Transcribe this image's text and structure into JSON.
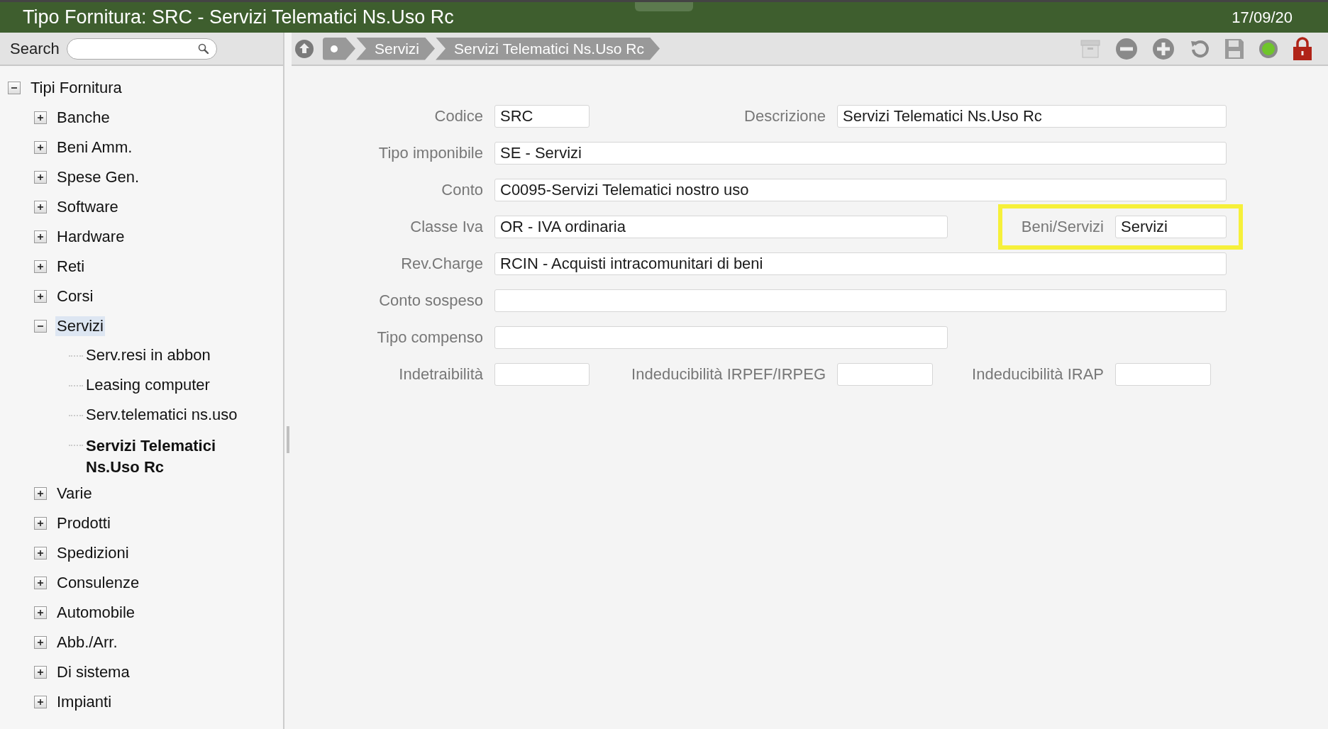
{
  "window": {
    "title": "Tipo Fornitura: SRC - Servizi Telematici Ns.Uso Rc",
    "date": "17/09/20"
  },
  "search": {
    "label": "Search"
  },
  "tree": {
    "label": "Tipi Fornitura",
    "expanded": true,
    "children": [
      {
        "label": "Banche",
        "expanded": false,
        "selected": false,
        "active": false
      },
      {
        "label": "Beni Amm.",
        "expanded": false,
        "selected": false,
        "active": false
      },
      {
        "label": "Spese Gen.",
        "expanded": false,
        "selected": false,
        "active": false
      },
      {
        "label": "Software",
        "expanded": false,
        "selected": false,
        "active": false
      },
      {
        "label": "Hardware",
        "expanded": false,
        "selected": false,
        "active": false
      },
      {
        "label": "Reti",
        "expanded": false,
        "selected": false,
        "active": false
      },
      {
        "label": "Corsi",
        "expanded": false,
        "selected": false,
        "active": false
      },
      {
        "label": "Servizi",
        "expanded": true,
        "selected": true,
        "active": false,
        "children": [
          {
            "label": "Serv.resi in abbon",
            "selected": false,
            "active": false
          },
          {
            "label": "Leasing computer",
            "selected": false,
            "active": false
          },
          {
            "label": "Serv.telematici ns.uso",
            "selected": false,
            "active": false
          },
          {
            "label": "Servizi Telematici Ns.Uso Rc",
            "selected": false,
            "active": true
          }
        ]
      },
      {
        "label": "Varie",
        "expanded": false,
        "selected": false,
        "active": false
      },
      {
        "label": "Prodotti",
        "expanded": false,
        "selected": false,
        "active": false
      },
      {
        "label": "Spedizioni",
        "expanded": false,
        "selected": false,
        "active": false
      },
      {
        "label": "Consulenze",
        "expanded": false,
        "selected": false,
        "active": false
      },
      {
        "label": "Automobile",
        "expanded": false,
        "selected": false,
        "active": false
      },
      {
        "label": "Abb./Arr.",
        "expanded": false,
        "selected": false,
        "active": false
      },
      {
        "label": "Di sistema",
        "expanded": false,
        "selected": false,
        "active": false
      },
      {
        "label": "Impianti",
        "expanded": false,
        "selected": false,
        "active": false
      }
    ]
  },
  "breadcrumb": [
    "Servizi",
    "Servizi Telematici Ns.Uso Rc"
  ],
  "form": [
    [
      {
        "label": "Codice",
        "value": "SRC",
        "highlighted": false
      },
      {
        "label": "Descrizione",
        "value": "Servizi Telematici Ns.Uso Rc",
        "highlighted": false
      }
    ],
    [
      {
        "label": "Tipo imponibile",
        "value": "SE - Servizi",
        "highlighted": false
      }
    ],
    [
      {
        "label": "Conto",
        "value": "C0095-Servizi Telematici nostro uso",
        "highlighted": false
      }
    ],
    [
      {
        "label": "Classe Iva",
        "value": "OR - IVA ordinaria",
        "highlighted": false
      },
      {
        "label": "Beni/Servizi",
        "value": "Servizi",
        "highlighted": true
      }
    ],
    [
      {
        "label": "Rev.Charge",
        "value": "RCIN - Acquisti intracomunitari di beni",
        "highlighted": false
      }
    ],
    [
      {
        "label": "Conto sospeso",
        "highlighted": false
      }
    ],
    [
      {
        "label": "Tipo compenso",
        "highlighted": false
      }
    ],
    [
      {
        "label": "Indetraibilità",
        "highlighted": false
      },
      {
        "label": "Indeducibilità IRPEF/IRPEG",
        "highlighted": false
      },
      {
        "label": "Indeducibilità IRAP",
        "highlighted": false
      }
    ]
  ]
}
